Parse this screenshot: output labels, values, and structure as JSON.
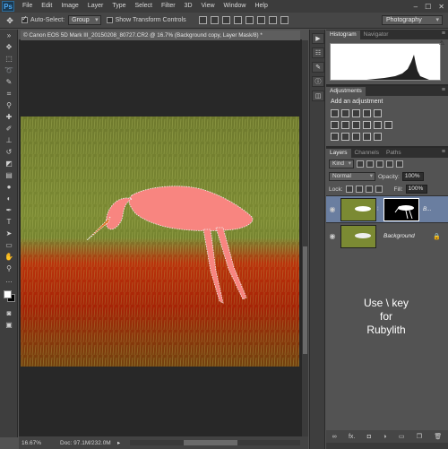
{
  "app": {
    "logo": "Ps"
  },
  "menu": [
    "File",
    "Edit",
    "Image",
    "Layer",
    "Type",
    "Select",
    "Filter",
    "3D",
    "View",
    "Window",
    "Help"
  ],
  "window_controls": {
    "minimize": "–",
    "maximize": "☐",
    "close": "✕"
  },
  "options_bar": {
    "auto_select_label": "Auto-Select:",
    "auto_select_value": "Group",
    "show_transform_label": "Show Transform Controls",
    "workspace": "Photography"
  },
  "document": {
    "tab_title": "© Canon EOS 5D Mark III_20150208_80727.CR2 @ 16.7% (Background copy, Layer Mask/8) *"
  },
  "status": {
    "zoom": "16.67%",
    "doc_size": "Doc: 97.1M/232.0M",
    "arrow": "▸"
  },
  "panels": {
    "histogram_tabs": [
      "Histogram",
      "Navigator"
    ],
    "histogram_warning": "⚠",
    "adjustments_tab": "Adjustments",
    "adjustments_title": "Add an adjustment",
    "layers_tabs": [
      "Layers",
      "Channels",
      "Paths"
    ],
    "kind_select": "Kind",
    "blend_mode": "Normal",
    "opacity_label": "Opacity:",
    "opacity_value": "100%",
    "lock_label": "Lock:",
    "fill_label": "Fill:",
    "fill_value": "100%",
    "layers": [
      {
        "name": "B...",
        "selected": true
      },
      {
        "name": "Background",
        "selected": false
      }
    ],
    "overlay_text": [
      "Use \\ key",
      "for",
      "Rubylith"
    ],
    "footer_icons": [
      "∞",
      "fx.",
      "◘",
      "◑",
      "▭",
      "❐",
      "🗑"
    ]
  },
  "colors": {
    "rubylith": "#ff3030",
    "selected_layer": "#6a7ea0",
    "workspace_bg": "#535353"
  }
}
